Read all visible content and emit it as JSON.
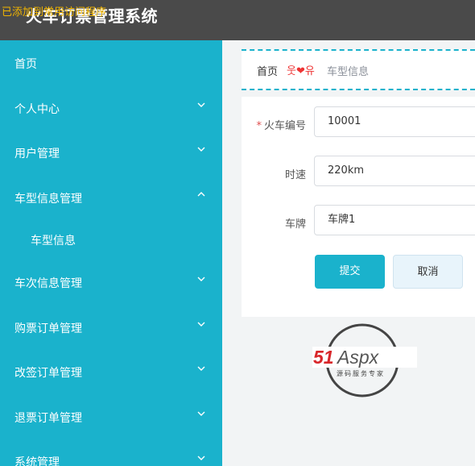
{
  "header": {
    "app_title": "火车订票管理系统",
    "toast": "已添加到常用访问程序"
  },
  "sidebar": {
    "items": [
      {
        "label": "首页",
        "icon": "",
        "expanded": false
      },
      {
        "label": "个人中心",
        "icon": "chevron-down-icon"
      },
      {
        "label": "用户管理",
        "icon": "chevron-down-icon"
      },
      {
        "label": "车型信息管理",
        "icon": "chevron-up-icon"
      },
      {
        "label": "车型信息",
        "sub": true
      },
      {
        "label": "车次信息管理",
        "icon": "chevron-down-icon"
      },
      {
        "label": "购票订单管理",
        "icon": "chevron-down-icon"
      },
      {
        "label": "改签订单管理",
        "icon": "chevron-down-icon"
      },
      {
        "label": "退票订单管理",
        "icon": "chevron-down-icon"
      },
      {
        "label": "系统管理",
        "icon": "chevron-down-icon"
      }
    ]
  },
  "breadcrumb": {
    "home": "首页",
    "separator": "웃❤유",
    "current": "车型信息"
  },
  "form": {
    "fields": [
      {
        "label": "火车编号",
        "required": true,
        "value": "10001"
      },
      {
        "label": "时速",
        "required": false,
        "value": "220km"
      },
      {
        "label": "车牌",
        "required": false,
        "value": "车牌1"
      }
    ],
    "submit_label": "提交",
    "cancel_label": "取消"
  },
  "watermark": {
    "brand": "51Aspx",
    "tagline": "源码服务专家"
  },
  "colors": {
    "accent": "#1ab2cc",
    "topbar": "#4a4a4a",
    "toast": "#f0b400",
    "required": "#e05050"
  }
}
